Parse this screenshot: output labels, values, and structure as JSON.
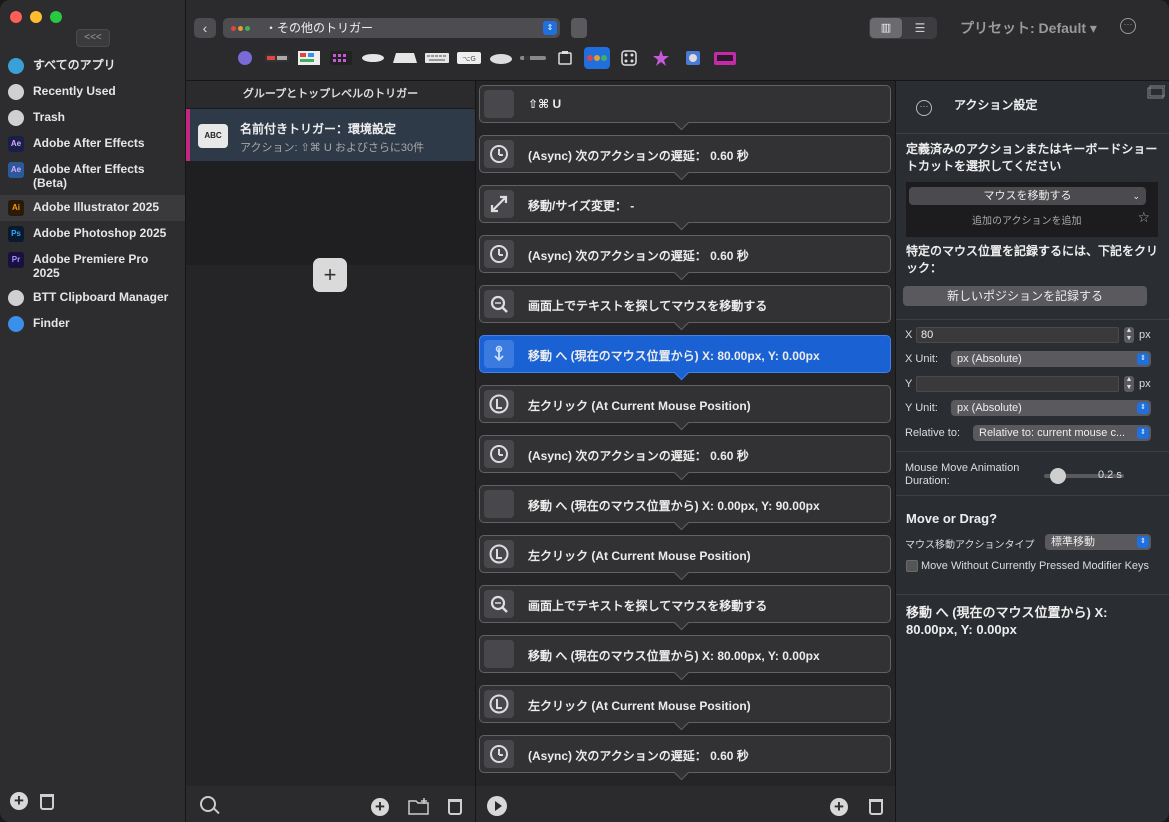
{
  "sidebar": {
    "collapse_label": "<<<",
    "apps": [
      {
        "label": "すべてのアプリ",
        "icon": "globe-icon",
        "color": "#3aa0d8"
      },
      {
        "label": "Recently Used",
        "icon": "clock-icon",
        "color": "#d0d0d0"
      },
      {
        "label": "Trash",
        "icon": "trash-icon",
        "color": "#d0d0d0"
      },
      {
        "label": "Adobe After Effects",
        "icon": "ae-icon",
        "badge": "Ae",
        "color": "#1a1f4a"
      },
      {
        "label": "Adobe After Effects (Beta)",
        "icon": "ae-beta-icon",
        "badge": "Ae",
        "color": "#2a5a9a"
      },
      {
        "label": "Adobe Illustrator 2025",
        "icon": "ai-icon",
        "badge": "Ai",
        "color": "#2a1a0a"
      },
      {
        "label": "Adobe Photoshop 2025",
        "icon": "ps-icon",
        "badge": "Ps",
        "color": "#0a1a2e"
      },
      {
        "label": "Adobe Premiere Pro 2025",
        "icon": "pr-icon",
        "badge": "Pr",
        "color": "#1a1040"
      },
      {
        "label": "BTT Clipboard Manager",
        "icon": "clipboard-icon",
        "color": "#d0d0d0"
      },
      {
        "label": "Finder",
        "icon": "finder-icon",
        "color": "#3a8fe8"
      }
    ]
  },
  "toolbar": {
    "back_label": "‹",
    "group_name": "・その他のトリガー",
    "preset_label": "プリセット: Default ▾",
    "view_grid_label": "▥",
    "view_list_label": "☰"
  },
  "triggers": {
    "header": "グループとトップレベルのトリガー",
    "item_icon_text": "ABC",
    "item_title": "名前付きトリガー：環境設定",
    "item_sub": "アクション: ⇧⌘ U およびさらに30件",
    "add_label": "+"
  },
  "actions": [
    {
      "label": "⇧⌘ U",
      "icon": "blank"
    },
    {
      "label": "(Async) 次のアクションの遅延： 0.60 秒",
      "icon": "clock"
    },
    {
      "label": "移動/サイズ変更： -",
      "icon": "resize"
    },
    {
      "label": "(Async) 次のアクションの遅延： 0.60 秒",
      "icon": "clock"
    },
    {
      "label": "画面上でテキストを探してマウスを移動する",
      "icon": "search"
    },
    {
      "label": "移動 へ (現在のマウス位置から) X: 80.00px, Y: 0.00px",
      "icon": "move",
      "selected": true
    },
    {
      "label": "左クリック (At Current Mouse Position)",
      "icon": "L"
    },
    {
      "label": "(Async) 次のアクションの遅延： 0.60 秒",
      "icon": "clock"
    },
    {
      "label": "移動 へ (現在のマウス位置から) X: 0.00px, Y: 90.00px",
      "icon": "blank"
    },
    {
      "label": "左クリック (At Current Mouse Position)",
      "icon": "L"
    },
    {
      "label": "画面上でテキストを探してマウスを移動する",
      "icon": "search"
    },
    {
      "label": "移動 へ (現在のマウス位置から) X: 80.00px, Y: 0.00px",
      "icon": "blank"
    },
    {
      "label": "左クリック (At Current Mouse Position)",
      "icon": "L"
    },
    {
      "label": "(Async) 次のアクションの遅延： 0.60 秒",
      "icon": "clock"
    }
  ],
  "settings": {
    "title": "アクション設定",
    "predefined_text": "定義済みのアクションまたはキーボードショートカットを選択してください",
    "mouse_action": "マウスを移動する",
    "add_action_label": "追加のアクションを追加",
    "record_hint": "特定のマウス位置を記録するには、下記をクリック：",
    "record_button": "新しいポジションを記録する",
    "x_label": "X",
    "x_value": "80",
    "y_label": "Y",
    "y_value": "",
    "unit_suffix": "px",
    "x_unit_label": "X Unit:",
    "x_unit_value": "px (Absolute)",
    "y_unit_label": "Y Unit:",
    "y_unit_value": "px (Absolute)",
    "relative_label": "Relative to:",
    "relative_value": "Relative to: current mouse c...",
    "anim_label": "Mouse Move Animation Duration:",
    "anim_value": "0.2 s",
    "anim_level": 0.1,
    "move_or_drag": "Move or Drag?",
    "move_type_label": "マウス移動アクションタイプ",
    "move_type_value": "標準移動",
    "checkbox_label": "Move Without Currently Pressed Modifier Keys",
    "summary": "移動 へ (現在のマウス位置から) X: 80.00px, Y: 0.00px"
  },
  "colors": {
    "accent": "#1f6fdf",
    "selected_action": "#1a62d4",
    "trigger_marker": "#c5267f"
  }
}
